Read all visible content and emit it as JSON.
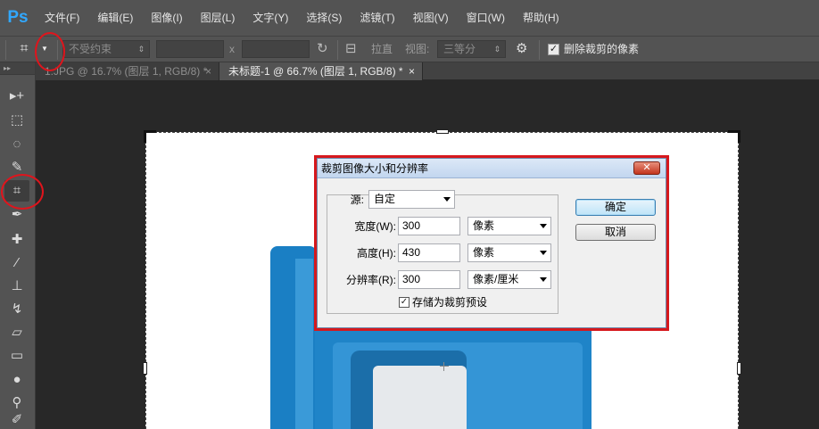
{
  "app": {
    "logo": "Ps",
    "menus": [
      "文件(F)",
      "编辑(E)",
      "图像(I)",
      "图层(L)",
      "文字(Y)",
      "选择(S)",
      "滤镜(T)",
      "视图(V)",
      "窗口(W)",
      "帮助(H)"
    ]
  },
  "options": {
    "constraint": "不受约束",
    "x_symbol": "x",
    "straighten_label": "拉直",
    "view_label": "视图:",
    "view_value": "三等分",
    "delete_pixels_label": "删除裁剪的像素",
    "delete_pixels_checked": true
  },
  "tabs": [
    {
      "label": "1.JPG @ 16.7% (图层 1, RGB/8) *",
      "close": "×"
    },
    {
      "label": "未标题-1 @ 66.7% (图层 1, RGB/8) *",
      "close": "×"
    }
  ],
  "toolbox": {
    "collapse": "▸▸",
    "tools": [
      {
        "name": "move-tool",
        "glyph": "▸+"
      },
      {
        "name": "marquee-tool",
        "glyph": "⬚"
      },
      {
        "name": "lasso-tool",
        "glyph": "◌"
      },
      {
        "name": "quick-select-tool",
        "glyph": "✎"
      },
      {
        "name": "crop-tool",
        "glyph": "⌗"
      },
      {
        "name": "eyedropper-tool",
        "glyph": "✒"
      },
      {
        "name": "healing-tool",
        "glyph": "✚"
      },
      {
        "name": "brush-tool",
        "glyph": "⁄"
      },
      {
        "name": "stamp-tool",
        "glyph": "⊥"
      },
      {
        "name": "history-brush-tool",
        "glyph": "↯"
      },
      {
        "name": "eraser-tool",
        "glyph": "▱"
      },
      {
        "name": "gradient-tool",
        "glyph": "▭"
      },
      {
        "name": "blur-tool",
        "glyph": "●"
      },
      {
        "name": "dodge-tool",
        "glyph": "⚲"
      },
      {
        "name": "pen-tool",
        "glyph": "✐"
      }
    ]
  },
  "dialog": {
    "title": "裁剪图像大小和分辨率",
    "close": "✕",
    "source_label": "源:",
    "source_value": "自定",
    "width_label": "宽度(W):",
    "width_value": "300",
    "width_unit": "像素",
    "height_label": "高度(H):",
    "height_value": "430",
    "height_unit": "像素",
    "resolution_label": "分辨率(R):",
    "resolution_value": "300",
    "resolution_unit": "像素/厘米",
    "save_preset_label": "存储为裁剪预设",
    "save_preset_checked": true,
    "ok_label": "确定",
    "cancel_label": "取消"
  }
}
